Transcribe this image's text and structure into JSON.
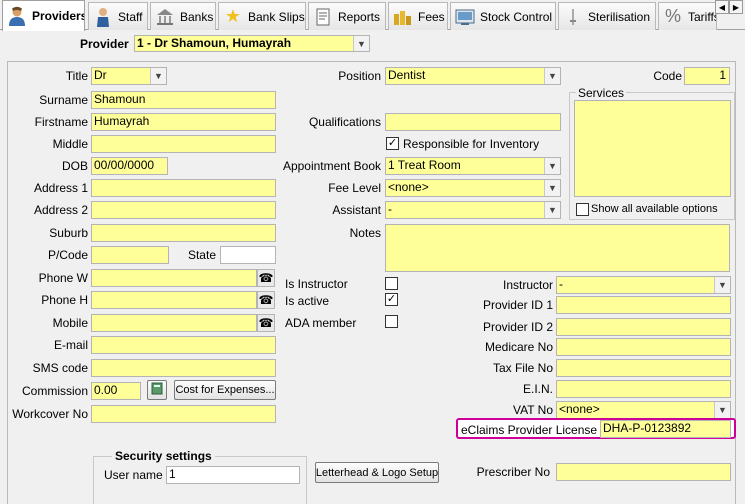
{
  "tabs": [
    {
      "label": "Providers",
      "icon": "person-icon"
    },
    {
      "label": "Staff",
      "icon": "staff-icon"
    },
    {
      "label": "Banks",
      "icon": "banks-icon"
    },
    {
      "label": "Bank Slips",
      "icon": "star-icon"
    },
    {
      "label": "Reports",
      "icon": "reports-icon"
    },
    {
      "label": "Fees",
      "icon": "fees-icon"
    },
    {
      "label": "Stock Control",
      "icon": "stock-icon"
    },
    {
      "label": "Sterilisation",
      "icon": "sterilisation-icon"
    },
    {
      "label": "Tariffs",
      "icon": "percent-icon"
    }
  ],
  "header": {
    "provider_label": "Provider",
    "provider_value": "1 - Dr Shamoun, Humayrah"
  },
  "left": {
    "title_label": "Title",
    "title_value": "Dr",
    "surname_label": "Surname",
    "surname_value": "Shamoun",
    "firstname_label": "Firstname",
    "firstname_value": "Humayrah",
    "middle_label": "Middle",
    "middle_value": "",
    "dob_label": "DOB",
    "dob_value": "00/00/0000",
    "address1_label": "Address 1",
    "address1_value": "",
    "address2_label": "Address 2",
    "address2_value": "",
    "suburb_label": "Suburb",
    "suburb_value": "",
    "pcode_label": "P/Code",
    "pcode_value": "",
    "state_label": "State",
    "state_value": "",
    "phonew_label": "Phone W",
    "phonew_value": "",
    "phoneh_label": "Phone H",
    "phoneh_value": "",
    "mobile_label": "Mobile",
    "mobile_value": "",
    "email_label": "E-mail",
    "email_value": "",
    "sms_label": "SMS code",
    "sms_value": "",
    "commission_label": "Commission",
    "commission_value": "0.00",
    "cost_button": "Cost for Expenses...",
    "workcover_label": "Workcover No",
    "workcover_value": ""
  },
  "middle": {
    "position_label": "Position",
    "position_value": "Dentist",
    "qualifications_label": "Qualifications",
    "qualifications_value": "",
    "responsible_label": "Responsible for Inventory",
    "responsible_checked": "✓",
    "appbook_label": "Appointment Book",
    "appbook_value": "1 Treat Room",
    "feelevel_label": "Fee Level",
    "feelevel_value": "<none>",
    "assistant_label": "Assistant",
    "assistant_value": "-",
    "notes_label": "Notes",
    "notes_value": "",
    "is_instructor_label": "Is Instructor",
    "is_instructor_checked": "",
    "is_active_label": "Is active",
    "is_active_checked": "✓",
    "ada_label": "ADA member",
    "ada_checked": ""
  },
  "right": {
    "code_label": "Code",
    "code_value": "1",
    "services_label": "Services",
    "show_all_label": "Show all available options",
    "instructor_label": "Instructor",
    "instructor_value": "-",
    "pid1_label": "Provider ID 1",
    "pid1_value": "",
    "pid2_label": "Provider ID 2",
    "pid2_value": "",
    "medicare_label": "Medicare No",
    "medicare_value": "",
    "taxfile_label": "Tax File No",
    "taxfile_value": "",
    "ein_label": "E.I.N.",
    "ein_value": "",
    "vat_label": "VAT No",
    "vat_value": "<none>",
    "eclaims_label": "eClaims Provider License",
    "eclaims_value": "DHA-P-0123892",
    "prescriber_label": "Prescriber No",
    "prescriber_value": ""
  },
  "security": {
    "title": "Security settings",
    "username_label": "User name",
    "username_value": "1",
    "letterhead_button": "Letterhead & Logo Setup"
  },
  "colors": {
    "field": "#ffff99",
    "highlight": "#cc0099"
  }
}
